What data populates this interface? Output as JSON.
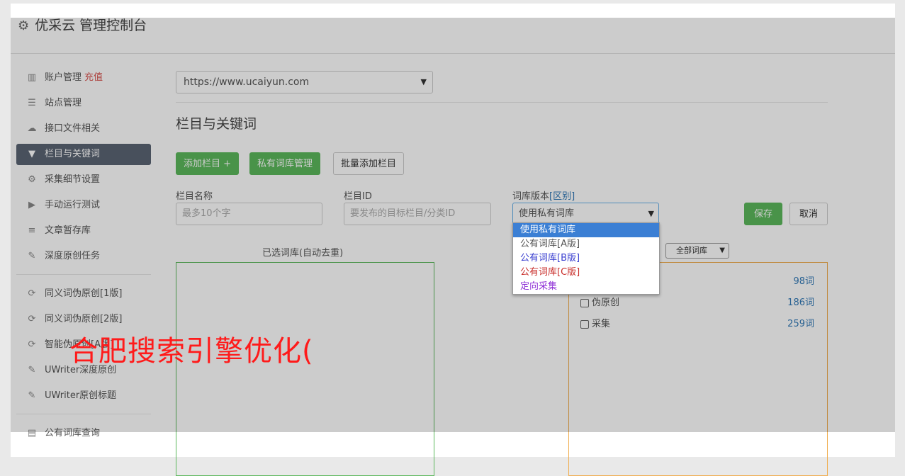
{
  "header": {
    "title": "优采云 管理控制台"
  },
  "sidebar": {
    "items": [
      {
        "icon": "bar-chart-icon",
        "label": "账户管理",
        "extra": "充值"
      },
      {
        "icon": "server-icon",
        "label": "站点管理"
      },
      {
        "icon": "cloud-upload-icon",
        "label": "接口文件相关"
      },
      {
        "icon": "filter-icon",
        "label": "栏目与关键词"
      },
      {
        "icon": "gears-icon",
        "label": "采集细节设置"
      },
      {
        "icon": "play-circle-icon",
        "label": "手动运行测试"
      },
      {
        "icon": "database-icon",
        "label": "文章暂存库"
      },
      {
        "icon": "edit-icon",
        "label": "深度原创任务"
      },
      {
        "icon": "refresh-icon",
        "label": "同义词伪原创[1版]"
      },
      {
        "icon": "refresh-icon",
        "label": "同义词伪原创[2版]"
      },
      {
        "icon": "refresh-icon",
        "label": "智能伪原创[A版]"
      },
      {
        "icon": "edit-icon",
        "label": "UWriter深度原创"
      },
      {
        "icon": "edit-icon",
        "label": "UWriter原创标题"
      },
      {
        "icon": "book-icon",
        "label": "公有词库查询"
      }
    ]
  },
  "main": {
    "site_select": "https://www.ucaiyun.com",
    "section_title": "栏目与关键词",
    "buttons": {
      "add_column": "添加栏目 +",
      "private_lib": "私有词库管理",
      "batch_add": "批量添加栏目"
    },
    "fields": {
      "column_name_label": "栏目名称",
      "column_name_placeholder": "最多10个字",
      "column_id_label": "栏目ID",
      "column_id_placeholder": "要发布的目标栏目/分类ID",
      "lib_version_label": "词库版本",
      "lib_version_link": "[区别]",
      "lib_version_value": "使用私有词库"
    },
    "save": "保存",
    "cancel": "取消",
    "dropdown_options": [
      {
        "label": "使用私有词库",
        "color": "#ffffff",
        "selected": true
      },
      {
        "label": "公有词库[A版]",
        "color": "#555555"
      },
      {
        "label": "公有词库[B版]",
        "color": "#3a3fd0"
      },
      {
        "label": "公有词库[C版]",
        "color": "#c9302c"
      },
      {
        "label": "定向采集",
        "color": "#8e30d6"
      }
    ],
    "selected_caption": "已选词库(自动去重)",
    "filter_select": "全部词库",
    "libraries": [
      {
        "name": "",
        "count": "98词"
      },
      {
        "name": "伪原创",
        "count": "186词"
      },
      {
        "name": "采集",
        "count": "259词"
      }
    ]
  },
  "watermark": "合肥搜索引擎优化(",
  "colors": {
    "accent_green": "#5cb85c",
    "active_nav": "#5b6574",
    "link": "#337ab7",
    "orange_border": "#f0ad4e",
    "watermark": "#ff1a1a"
  }
}
